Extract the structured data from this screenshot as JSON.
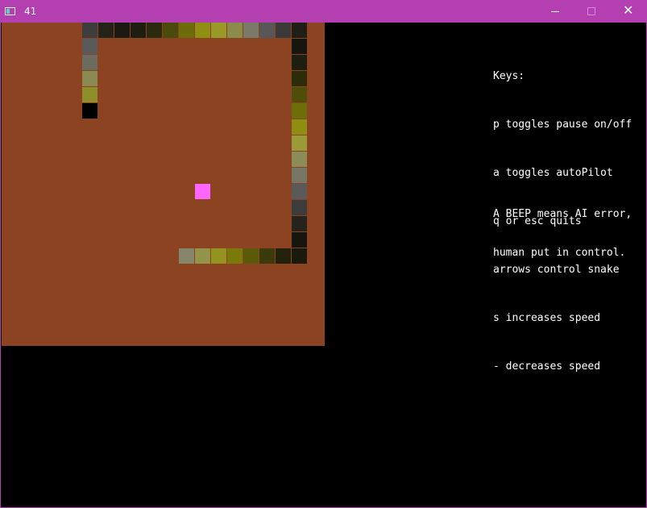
{
  "window": {
    "title": "41",
    "icon": "app-window-icon",
    "titlebar_color": "#b43fb0",
    "controls": {
      "minimize_icon": "minimize-icon",
      "maximize_icon": "maximize-icon",
      "close_label": "✕"
    }
  },
  "game": {
    "grid_size": 20,
    "board_color": "#8b4322",
    "food": {
      "col": 12,
      "row": 10,
      "color": "#ff66ff"
    },
    "snake": [
      {
        "col": 5,
        "row": 5,
        "color": "#000000"
      },
      {
        "col": 5,
        "row": 4,
        "color": "#8e8e2a"
      },
      {
        "col": 5,
        "row": 3,
        "color": "#8a8a52"
      },
      {
        "col": 5,
        "row": 2,
        "color": "#6b6b60"
      },
      {
        "col": 5,
        "row": 1,
        "color": "#5a5a5a"
      },
      {
        "col": 5,
        "row": 0,
        "color": "#3d3d3d"
      },
      {
        "col": 6,
        "row": 0,
        "color": "#23231a"
      },
      {
        "col": 7,
        "row": 0,
        "color": "#1a1a12"
      },
      {
        "col": 8,
        "row": 0,
        "color": "#1e1e10"
      },
      {
        "col": 9,
        "row": 0,
        "color": "#2a2a0e"
      },
      {
        "col": 10,
        "row": 0,
        "color": "#4a4a0a"
      },
      {
        "col": 11,
        "row": 0,
        "color": "#6c6c0a"
      },
      {
        "col": 12,
        "row": 0,
        "color": "#8f8f12"
      },
      {
        "col": 13,
        "row": 0,
        "color": "#9a9a28"
      },
      {
        "col": 14,
        "row": 0,
        "color": "#8c8c4a"
      },
      {
        "col": 15,
        "row": 0,
        "color": "#7a7a6a"
      },
      {
        "col": 16,
        "row": 0,
        "color": "#575757"
      },
      {
        "col": 17,
        "row": 0,
        "color": "#3a3a3a"
      },
      {
        "col": 18,
        "row": 0,
        "color": "#1f1f18"
      },
      {
        "col": 18,
        "row": 1,
        "color": "#161610"
      },
      {
        "col": 18,
        "row": 2,
        "color": "#1e1e10"
      },
      {
        "col": 18,
        "row": 3,
        "color": "#2c2c08"
      },
      {
        "col": 18,
        "row": 4,
        "color": "#4e4e08"
      },
      {
        "col": 18,
        "row": 5,
        "color": "#6e6e08"
      },
      {
        "col": 18,
        "row": 6,
        "color": "#8e8e12"
      },
      {
        "col": 18,
        "row": 7,
        "color": "#9a9a38"
      },
      {
        "col": 18,
        "row": 8,
        "color": "#8c8c58"
      },
      {
        "col": 18,
        "row": 9,
        "color": "#777768"
      },
      {
        "col": 18,
        "row": 10,
        "color": "#5a5a5a"
      },
      {
        "col": 18,
        "row": 11,
        "color": "#3c3c3c"
      },
      {
        "col": 18,
        "row": 12,
        "color": "#24241c"
      },
      {
        "col": 18,
        "row": 13,
        "color": "#161610"
      },
      {
        "col": 18,
        "row": 14,
        "color": "#1a1a0c"
      },
      {
        "col": 17,
        "row": 14,
        "color": "#22220c"
      },
      {
        "col": 16,
        "row": 14,
        "color": "#3a3a0a"
      },
      {
        "col": 15,
        "row": 14,
        "color": "#5a5a08"
      },
      {
        "col": 14,
        "row": 14,
        "color": "#7a7a0a"
      },
      {
        "col": 13,
        "row": 14,
        "color": "#939320"
      },
      {
        "col": 12,
        "row": 14,
        "color": "#93934a"
      },
      {
        "col": 11,
        "row": 14,
        "color": "#86866a"
      }
    ]
  },
  "help": {
    "lines": [
      "Keys:",
      "p toggles pause on/off",
      "a toggles autoPilot",
      "q or esc quits",
      "arrows control snake",
      "s increases speed",
      "- decreases speed"
    ],
    "beep_line1": "A BEEP means AI error,",
    "beep_line2": "human put in control."
  }
}
